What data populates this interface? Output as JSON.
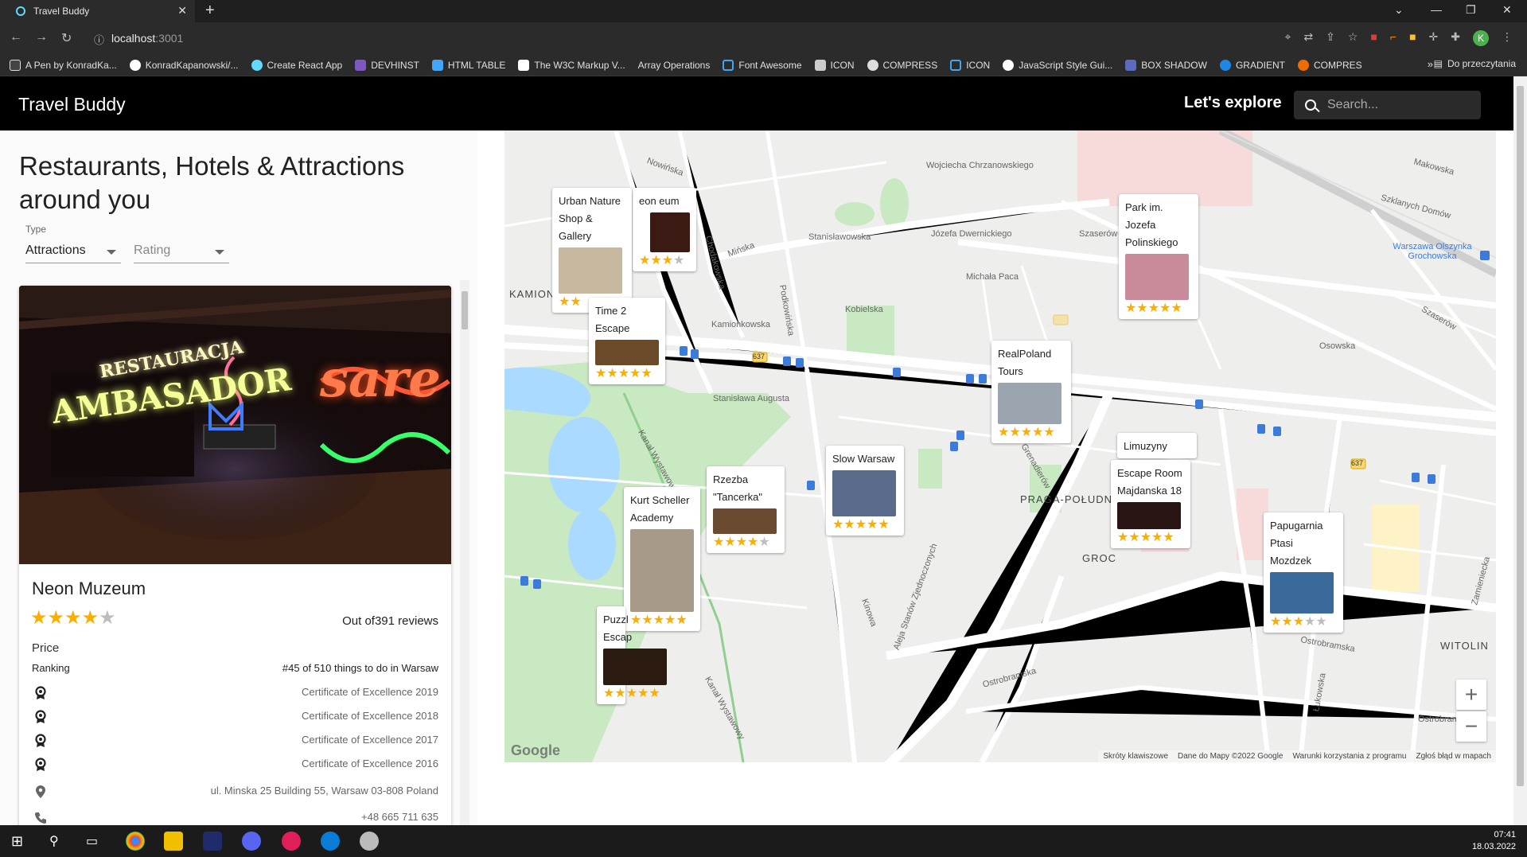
{
  "browser": {
    "tab_title": "Travel Buddy",
    "url_host": "localhost",
    "url_port": ":3001",
    "profile_initial": "K",
    "bookmarks": [
      "A Pen by KonradKa...",
      "KonradKapanowski/...",
      "Create React App",
      "DEVHINST",
      "HTML TABLE",
      "The W3C Markup V...",
      "Array Operations",
      "Font Awesome",
      "ICON",
      "COMPRESS",
      "ICON",
      "JavaScript Style Gui...",
      "BOX SHADOW",
      "GRADIENT",
      "COMPRES"
    ],
    "bookmarks_more": "»",
    "reading_list": "Do przeczytania"
  },
  "header": {
    "brand": "Travel Buddy",
    "explore": "Let's explore",
    "search_placeholder": "Search..."
  },
  "panel": {
    "title": "Restaurants, Hotels & Attractions around you",
    "type_label": "Type",
    "type_value": "Attractions",
    "rating_placeholder": "Rating"
  },
  "place_card": {
    "name": "Neon Muzeum",
    "rating": 4,
    "reviews": "Out of391 reviews",
    "price_label": "Price",
    "ranking_label": "Ranking",
    "ranking_value": "#45 of 510 things to do in Warsaw",
    "awards": [
      "Certificate of Excellence 2019",
      "Certificate of Excellence 2018",
      "Certificate of Excellence 2017",
      "Certificate of Excellence 2016"
    ],
    "address": "ul. Minska 25 Building 55, Warsaw 03-808 Poland",
    "phone": "+48 665 711 635",
    "image_text": [
      "RESTAURACJA",
      "AMBASADOR",
      "sare"
    ]
  },
  "map": {
    "labels": {
      "kamionek": "KAMIONEK",
      "praga": "PRAGA-POŁUDNIE",
      "grochow": "GROC",
      "witolin": "WITOLIN",
      "station": "Warszawa Olszynka Grochowska",
      "s1": "Stanisławowska",
      "s2": "Józefa Dwernickiego",
      "s3": "Mińska",
      "s4": "Szaserów",
      "s5": "Grochowska",
      "s6": "Ostrobramska",
      "s7": "Aleja Stanów Zjednoczonych",
      "s8": "Kanał Wystawowy",
      "s9": "Kinowa",
      "s10": "Kamionkowska",
      "s11": "Stanisława Augusta",
      "s12": "Chodakowska",
      "s13": "Kobielska",
      "s14": "Zamieniecka",
      "s15": "Nowińska",
      "s16": "Wojciecha Chrzanowskiego",
      "s17": "Michała Paca",
      "s18": "Osowska",
      "s19": "Grenadierów",
      "s20": "Łukowska",
      "s21": "Podkowińska",
      "s22": "Makowska",
      "s23": "Szklanych Domów",
      "road_637": "637"
    },
    "zoom_in": "+",
    "zoom_out": "−",
    "attribution": [
      "Skróty klawiszowe",
      "Dane do Mapy ©2022 Google",
      "Warunki korzystania z programu",
      "Zgłoś błąd w mapach"
    ],
    "google": "Google",
    "pins": [
      {
        "name": "Urban Nature Shop & Gallery",
        "rating": 2,
        "color": "#c9b8a0"
      },
      {
        "name": "Neon Muzeum",
        "name_visible": "eon eum",
        "rating": 3,
        "color": "#3a1a12"
      },
      {
        "name": "Time 2 Escape",
        "rating": 5,
        "color": "#6b4a2a"
      },
      {
        "name": "Park im. Jozefa Polinskiego",
        "rating": 5,
        "color": "#c98a9a"
      },
      {
        "name": "RealPoland Tours",
        "rating": 5,
        "color": "#9aa5b0"
      },
      {
        "name": "Limuzyny",
        "rating": 0,
        "color": "#333"
      },
      {
        "name": "Escape Room Majdanska 18",
        "rating": 5,
        "color": "#2a1515"
      },
      {
        "name": "Slow Warsaw",
        "rating": 5,
        "color": "#5a6a8a"
      },
      {
        "name": "Rzezba \"Tancerka\"",
        "rating": 4,
        "color": "#6a4a30"
      },
      {
        "name": "Kurt Scheller Academy",
        "rating": 5,
        "color": "#a89a88"
      },
      {
        "name": "Puzzl Escap",
        "rating": 5,
        "color": "#2a1a10"
      },
      {
        "name": "Papugarnia Ptasi Mozdzek",
        "rating": 3,
        "color": "#3a6a9a"
      }
    ]
  },
  "taskbar": {
    "time": "07:41",
    "date": "18.03.2022"
  }
}
